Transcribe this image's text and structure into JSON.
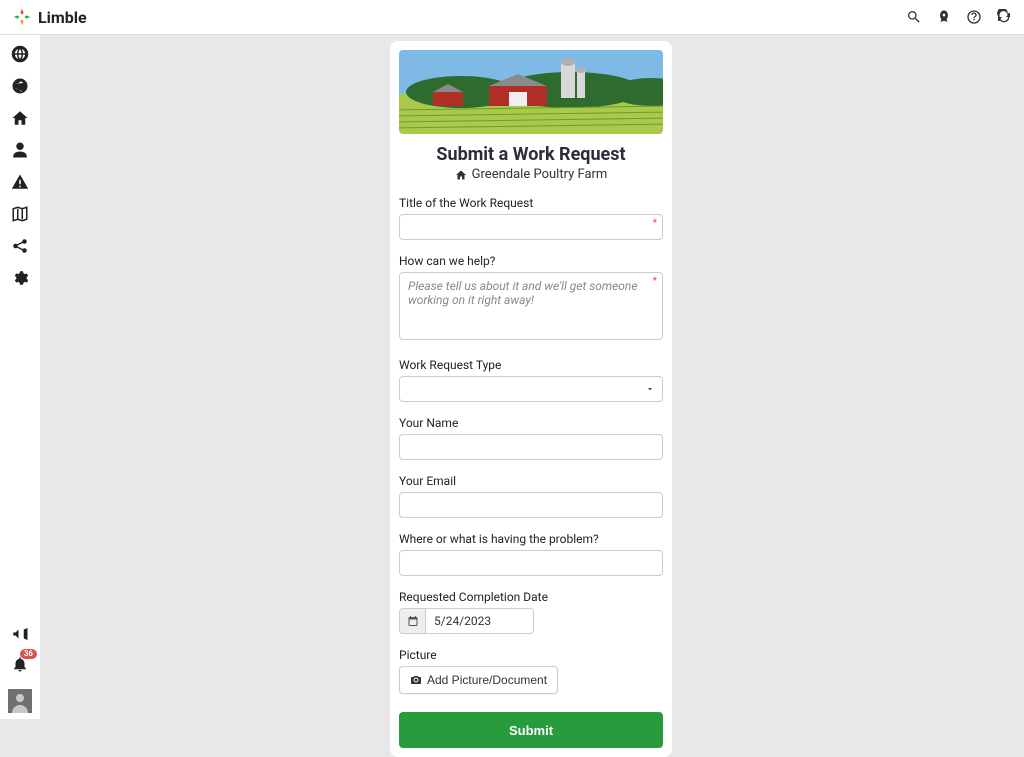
{
  "brand": {
    "name": "Limble"
  },
  "notifications": {
    "count": "36"
  },
  "form": {
    "title": "Submit a Work Request",
    "location": "Greendale Poultry Farm",
    "fields": {
      "title_label": "Title of the Work Request",
      "help_label": "How can we help?",
      "help_placeholder": "Please tell us about it and we'll get someone working on it right away!",
      "type_label": "Work Request Type",
      "name_label": "Your Name",
      "email_label": "Your Email",
      "where_label": "Where or what is having the problem?",
      "date_label": "Requested Completion Date",
      "date_value": "5/24/2023",
      "picture_label": "Picture",
      "upload_button": "Add Picture/Document"
    },
    "submit": "Submit"
  }
}
